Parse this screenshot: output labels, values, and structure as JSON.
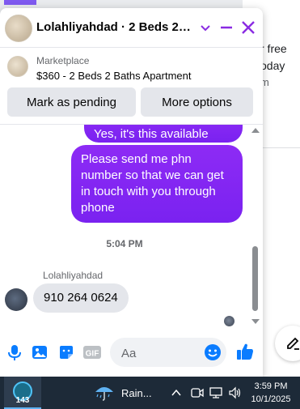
{
  "background": {
    "line1": "r free",
    "line2": "oday",
    "line3": "m"
  },
  "chat": {
    "title": "Lolahliyahdad · 2 Beds 2 B...",
    "listing_label": "Marketplace",
    "listing_title": "$360 - 2 Beds 2 Baths Apartment",
    "mark_pending_label": "Mark as pending",
    "more_options_label": "More options",
    "messages": {
      "outgoing_partial": "Yes, it's this available now.",
      "outgoing_main": "Please send me  phn number so that we can get in touch with you through phone",
      "timestamp": "5:04 PM",
      "sender_name": "Lolahliyahdad",
      "incoming": "910 264 0624"
    },
    "composer": {
      "placeholder": "Aa"
    },
    "accent_color": "#8a2be2"
  },
  "taskbar": {
    "badge_count": "143",
    "weather_label": "Rain...",
    "time": "3:59 PM",
    "date": "10/1/2025"
  }
}
